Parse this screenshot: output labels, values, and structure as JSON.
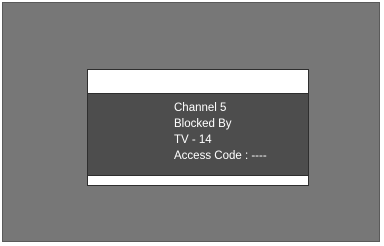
{
  "block_message": {
    "channel": "Channel 5",
    "blocked_by_label": "Blocked By",
    "rating": "TV - 14",
    "access_code_label": "Access Code : ----"
  }
}
